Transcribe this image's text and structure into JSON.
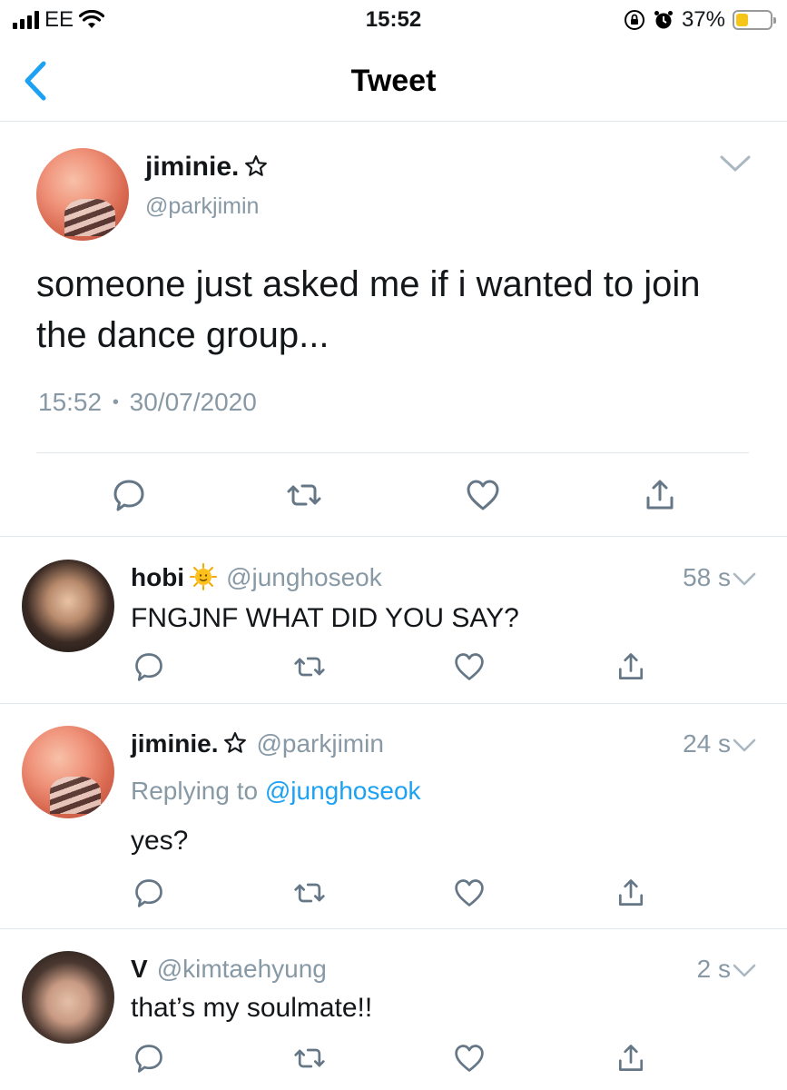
{
  "status_bar": {
    "carrier": "EE",
    "time": "15:52",
    "battery": "37%",
    "battery_level": 0.37
  },
  "nav": {
    "title": "Tweet"
  },
  "main_tweet": {
    "name": "jiminie.",
    "handle": "@parkjimin",
    "text": "someone just asked me if i wanted to join the dance group...",
    "time": "15:52",
    "separator": "•",
    "date": "30/07/2020"
  },
  "replies": [
    {
      "name": "hobi",
      "handle": "@junghoseok",
      "time": "58 s",
      "text": "FNGJNF WHAT DID YOU SAY?"
    },
    {
      "name": "jiminie.",
      "handle": "@parkjimin",
      "time": "24 s",
      "replying_label": "Replying to",
      "replying_to": "@junghoseok",
      "text": "yes?"
    },
    {
      "name": "V",
      "handle": "@kimtaehyung",
      "time": "2 s",
      "text": "that’s my soulmate!!"
    }
  ],
  "colors": {
    "accent": "#1da1f2",
    "secondary_text": "#8899a6",
    "icon": "#657786",
    "divider": "#e1e8ed"
  },
  "icons": {
    "back": "chevron-left-icon",
    "reply": "reply-icon",
    "retweet": "retweet-icon",
    "like": "heart-icon",
    "share": "share-icon",
    "more": "chevron-down-icon"
  }
}
